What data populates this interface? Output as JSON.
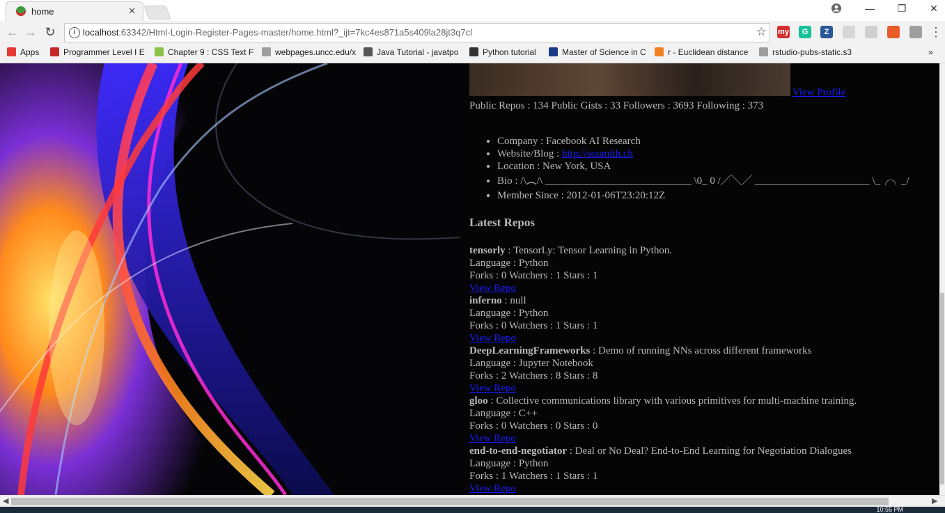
{
  "browser": {
    "tab_title": "home",
    "tab_close": "✕",
    "url_host": "localhost",
    "url_rest": ":63342/Html-Login-Register-Pages-master/home.html?_ijt=7kc4es871a5s409la28jt3q7cl",
    "window_controls": {
      "minimize": "—",
      "restore": "❐",
      "close": "✕"
    },
    "extensions": [
      {
        "name": "myhomework-icon",
        "label": "my",
        "color": "#d32f2f"
      },
      {
        "name": "grammarly-icon",
        "label": "G",
        "color": "#15c39a"
      },
      {
        "name": "zotero-icon",
        "label": "Z",
        "color": "#2b5797"
      },
      {
        "name": "extension-icon",
        "label": "",
        "color": "#d6d6d6"
      },
      {
        "name": "pdf-icon",
        "label": "",
        "color": "#cfcfcf"
      },
      {
        "name": "adblock-icon",
        "label": "",
        "color": "#e85d2a"
      },
      {
        "name": "shield-extension-icon",
        "label": "",
        "color": "#9e9e9e"
      }
    ]
  },
  "bookmarks": [
    {
      "label": "Apps",
      "color": "#e53935"
    },
    {
      "label": "Programmer Level I E",
      "color": "#c62828"
    },
    {
      "label": "Chapter 9 : CSS Text F",
      "color": "#8bc34a"
    },
    {
      "label": "webpages.uncc.edu/x",
      "color": "#9e9e9e"
    },
    {
      "label": "Java Tutorial - javatpo",
      "color": "#555555"
    },
    {
      "label": "Python tutorial",
      "color": "#333333"
    },
    {
      "label": "Master of Science in C",
      "color": "#1a3a8a"
    },
    {
      "label": "r - Euclidean distance",
      "color": "#f48024"
    },
    {
      "label": "rstudio-pubs-static.s3",
      "color": "#9e9e9e"
    }
  ],
  "bookmarks_more": "»",
  "profile": {
    "view_profile": "View Profile",
    "stats": "Public Repos : 134 Public Gists : 33 Followers : 3693 Following : 373",
    "company": "Company : Facebook AI Research",
    "website_label": "Website/Blog : ",
    "website_url": "http://soumith.ch",
    "location": "Location : New York, USA",
    "bio": "Bio : /\\︵/\\ ____________________________ \\0_ 0 /╱╲╱ ______________________ \\_╭╮_/",
    "member_since": "Member Since : 2012-01-06T23:20:12Z"
  },
  "latest_repos_heading": "Latest Repos",
  "repos": [
    {
      "name": "tensorly",
      "desc": " : TensorLy: Tensor Learning in Python.",
      "language": "Language : Python",
      "counts": "Forks : 0 Watchers : 1 Stars : 1",
      "link": "View Repo"
    },
    {
      "name": "inferno",
      "desc": " : null",
      "language": "Language : Python",
      "counts": "Forks : 0 Watchers : 1 Stars : 1",
      "link": "View Repo"
    },
    {
      "name": "DeepLearningFrameworks",
      "desc": " : Demo of running NNs across different frameworks",
      "language": "Language : Jupyter Notebook",
      "counts": "Forks : 2 Watchers : 8 Stars : 8",
      "link": "View Repo"
    },
    {
      "name": "gloo",
      "desc": " : Collective communications library with various primitives for multi-machine training.",
      "language": "Language : C++",
      "counts": "Forks : 0 Watchers : 0 Stars : 0",
      "link": "View Repo"
    },
    {
      "name": "end-to-end-negotiator",
      "desc": " : Deal or No Deal? End-to-End Learning for Negotiation Dialogues",
      "language": "Language : Python",
      "counts": "Forks : 1 Watchers : 1 Stars : 1",
      "link": "View Repo"
    }
  ],
  "taskbar_clock": "10:55 PM"
}
